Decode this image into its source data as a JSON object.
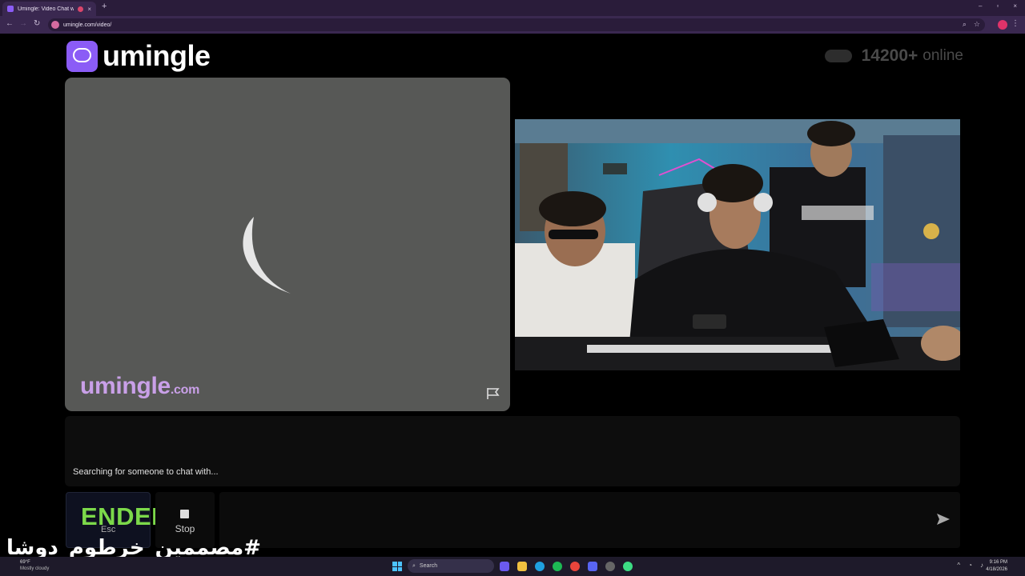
{
  "browser": {
    "tab_title": "Umingle: Video Chat with S",
    "tab_close": "×",
    "new_tab": "+",
    "window_controls": [
      "–",
      "▫",
      "×"
    ],
    "url": "umingle.com/video/"
  },
  "header": {
    "logo_text": "umingle",
    "online_count": "14200+",
    "online_label": "online"
  },
  "left_video": {
    "watermark_main": "umingle",
    "watermark_suffix": ".com"
  },
  "chat": {
    "status_text": "Searching for someone to chat with..."
  },
  "controls": {
    "esc_label": "Esc",
    "stop_label": "Stop",
    "overlay_text": "ENDED"
  },
  "caption": "#مصممين_خرطوم_دوشا",
  "taskbar": {
    "weather_temp": "69°F",
    "weather_desc": "Mostly cloudy",
    "search_placeholder": "Search",
    "time": "9:16 PM",
    "date": "4/18/2026"
  },
  "colors": {
    "brand": "#8b5cf6",
    "watermark": "#c9a0e8",
    "ended": "#7cd94a"
  }
}
